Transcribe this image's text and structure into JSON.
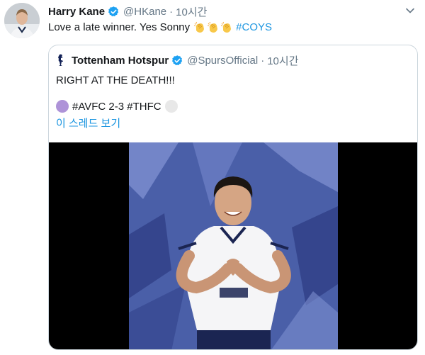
{
  "tweet": {
    "display_name": "Harry Kane",
    "handle": "@HKane",
    "separator": "·",
    "time": "10시간",
    "text": "Love a late winner. Yes Sonny",
    "hashtag": "#COYS",
    "avatar_icon": "player-avatar"
  },
  "quoted": {
    "display_name": "Tottenham Hotspur",
    "handle": "@SpursOfficial",
    "separator": "·",
    "time": "10시간",
    "text": "RIGHT AT THE DEATH!!!",
    "score_line": "#AVFC 2-3 #THFC",
    "thread_link": "이 스레드 보기"
  },
  "colors": {
    "link": "#1b95e0",
    "muted": "#657786",
    "verified": "#1da1f2",
    "border": "#ccd6dd"
  }
}
